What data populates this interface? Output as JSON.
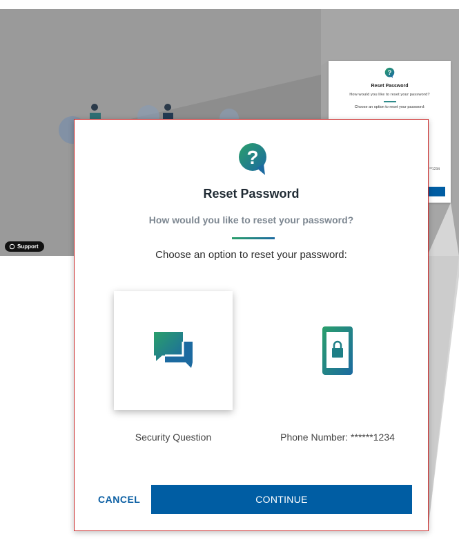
{
  "background": {
    "support_label": "Support"
  },
  "mini_preview": {
    "title": "Reset Password",
    "subtitle": "How would you like to reset your password?",
    "choose_text": "Choose an option to reset your password:",
    "phone_fragment": "**1234"
  },
  "dialog": {
    "title": "Reset Password",
    "subtitle": "How would you like to reset your password?",
    "choose_text": "Choose an option to reset your password:",
    "options": [
      {
        "label": "Security Question",
        "icon": "chat-bubbles-icon"
      },
      {
        "label": "Phone Number: ******1234",
        "icon": "phone-lock-icon"
      }
    ],
    "cancel_label": "CANCEL",
    "continue_label": "CONTINUE"
  },
  "colors": {
    "primary": "#005da3",
    "accent_green": "#2a9f6b",
    "accent_blue": "#1c6aa0",
    "dialog_border": "#cc2b2b"
  }
}
